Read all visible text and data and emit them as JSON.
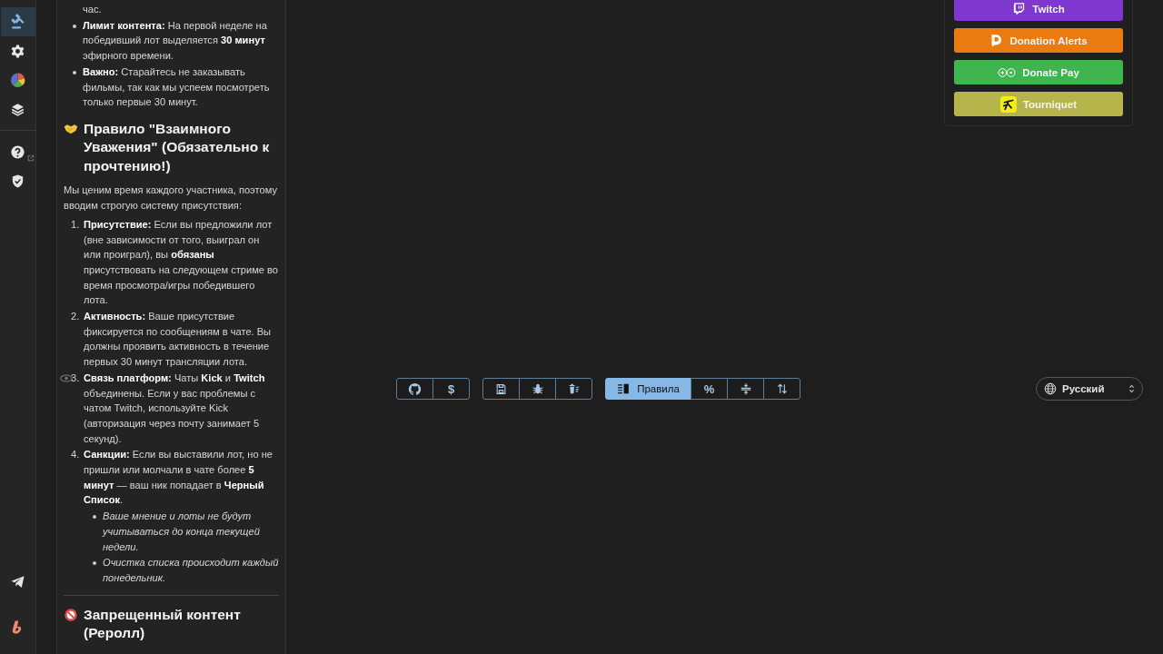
{
  "sidebar": {
    "items": [
      {
        "kind": "gavel",
        "selected": true
      },
      {
        "kind": "gear",
        "selected": false
      },
      {
        "kind": "pie",
        "selected": false
      },
      {
        "kind": "layers",
        "selected": false
      }
    ],
    "help_items": [
      {
        "kind": "help",
        "external": true
      },
      {
        "kind": "shield",
        "external": false
      }
    ],
    "bottom_items": [
      {
        "kind": "telegram"
      },
      {
        "kind": "logo"
      }
    ]
  },
  "rules": {
    "continuation": "час.",
    "bullets": [
      "**Лимит контента:** На первой неделе на победивший лот выделяется **30 минут** эфирного времени.",
      "**Важно:** Старайтесь не заказывать фильмы, так как мы успеем посмотреть только первые 30 минут."
    ],
    "section": {
      "kind": "handshake",
      "title": "Правило \"Взаимного Уважения\" (Обязательно к прочтению!)",
      "intro": "Мы ценим время каждого участника, поэтому вводим строгую систему присутствия:",
      "items": [
        {
          "number": "1.",
          "text": "**Присутствие:** Если вы предложили лот (вне зависимости от того, выиграл он или проиграл), вы **обязаны** присутствовать на следующем стриме во время просмотра/игры победившего лота."
        },
        {
          "number": "2.",
          "text": "**Активность:** Ваше присутствие фиксируется по сообщениям в чате. Вы должны проявить активность в течение первых 30 минут трансляции лота."
        },
        {
          "number": "3.",
          "text": "**Связь платформ:** Чаты **Kick** и **Twitch** объединены. Если у вас проблемы с чатом Twitch, используйте Kick (авторизация через почту занимает 5 секунд).",
          "eye": true
        },
        {
          "number": "4.",
          "text": "**Санкции:** Если вы выставили лот, но не пришли или молчали в чате более **5 минут** — ваш ник попадает в **Черный Список**.",
          "sub": [
            "Ваше мнение и лоты не будут учитываться до конца текущей недели.",
            "Очистка списка происходит каждый понедельник."
          ]
        }
      ]
    },
    "next_section": {
      "kind": "no-entry",
      "title": "Запрещенный контент (Реролл)"
    }
  },
  "donation_buttons": [
    {
      "kind": "twitch",
      "label": "Twitch",
      "color": "#7e38cf"
    },
    {
      "kind": "donationalerts",
      "label": "Donation Alerts",
      "color": "#e97b10"
    },
    {
      "kind": "donatepay",
      "label": "Donate Pay",
      "color": "#3eb54f"
    },
    {
      "kind": "tourniquet",
      "label": "Tourniquet",
      "color": "#b6b54b"
    }
  ],
  "toolbar": {
    "groups": [
      [
        {
          "kind": "github",
          "selected": false
        },
        {
          "kind": "text",
          "label": "$",
          "selected": false
        }
      ],
      [
        {
          "kind": "save",
          "selected": false
        },
        {
          "kind": "bug",
          "selected": false
        },
        {
          "kind": "clear",
          "selected": false
        }
      ],
      [
        {
          "kind": "rules",
          "label": "Правила",
          "selected": true
        },
        {
          "kind": "text",
          "label": "%",
          "selected": false
        },
        {
          "kind": "collapse",
          "selected": false
        },
        {
          "kind": "sort",
          "selected": false
        }
      ]
    ]
  },
  "language": {
    "value": "Русский"
  }
}
